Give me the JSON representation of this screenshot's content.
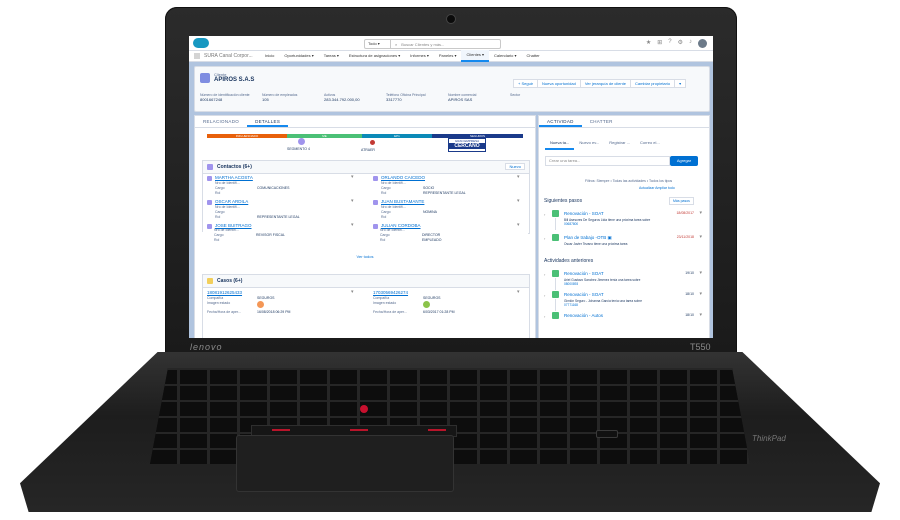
{
  "laptop": {
    "brand": "lenovo",
    "model": "T550",
    "logo": "ThinkPad"
  },
  "sf": {
    "search": {
      "scope": "Todo ▾",
      "placeholder": "Buscar Clientes y más..."
    },
    "app_name": "SURA Canal Corpor...",
    "nav_tabs": [
      "Inicio",
      "Oportunidades ▾",
      "Tareas ▾",
      "Estructura de asignaciones ▾",
      "Informes ▾",
      "Paneles ▾",
      "Clientes ▾",
      "Calendario ▾",
      "Chatter"
    ],
    "active_tab": "Clientes ▾",
    "record": {
      "object": "Cliente",
      "name": "APIROS S.A.S",
      "actions": [
        "+ Seguir",
        "Nueva oportunidad",
        "Ver jerarquía de cliente",
        "Cambiar propietario",
        "▾"
      ],
      "fields": [
        {
          "label": "Número de identificación cliente",
          "value": "8001667248"
        },
        {
          "label": "Número de empleados",
          "value": "105"
        },
        {
          "label": "Activos",
          "value": "283.344.792.000,00"
        },
        {
          "label": "Teléfono Oficina Principal",
          "value": "3317770"
        },
        {
          "label": "Nombre comercial",
          "value": "APIROS SAS"
        },
        {
          "label": "Sector",
          "value": ""
        }
      ]
    },
    "left_tabs": [
      "RELACIONADO",
      "DETALLES"
    ],
    "path": {
      "segments": [
        "INFLUENCIADO",
        "ME",
        "EP1",
        "SEGUROS"
      ],
      "colors": [
        "#e8600a",
        "#4bc076",
        "#0b8ab8",
        "#1a3a8a"
      ],
      "label1": "SEGMENTO 4",
      "label2": "ATRAER",
      "gran1": "GRAN EMPRESA",
      "gran2": "CERCANO"
    },
    "contacts": {
      "title": "Contactos (6+)",
      "button": "Nuevo",
      "items": [
        {
          "name": "MARTHA ACOSTA",
          "cargo": "",
          "rol": "COMUNICACIONES"
        },
        {
          "name": "ORLANDO CAICEDO",
          "cargo": "SOCIO",
          "rol": "REPRESENTANTE LEGAL"
        },
        {
          "name": "OSCAR ARDILA",
          "cargo": "",
          "rol": "REPRESENTANTE LEGAL"
        },
        {
          "name": "JUAN BUSTAMANTE",
          "cargo": "",
          "rol": "NOMINA"
        },
        {
          "name": "JOSE BUITRAGO",
          "cargo": "",
          "rol": "REVISOR FISCAL"
        },
        {
          "name": "JULIAN CORDOBA",
          "cargo": "DIRECTOR",
          "rol": "EMPLEADO"
        }
      ],
      "lbl_ident": "Nro de Identifi...",
      "lbl_cargo": "Cargo",
      "lbl_rol": "Rol",
      "see_all": "Ver todos"
    },
    "cases": {
      "title": "Casos (6+)",
      "items": [
        {
          "num": "18081912625433",
          "company": "SEGUROS",
          "date": "16/08/2018 06:29 PM"
        },
        {
          "num": "17030569426274",
          "company": "SEGUROS",
          "date": "6/03/2017 01:28 PM"
        }
      ],
      "lbl_company": "Compañía",
      "lbl_state": "Imagen estado",
      "lbl_date": "Fecha/Hora de aper..."
    },
    "right_tabs": [
      "ACTIVIDAD",
      "CHATTER"
    ],
    "activity_tabs": [
      "Nueva ta...",
      "Nuevo ev...",
      "Registrar ...",
      "Correo el..."
    ],
    "task_placeholder": "Crear una tarea...",
    "add_button": "Agregar",
    "filters": "Filtros: Siempre • Todas las actividades • Todos los tipos",
    "filter_links": "Actualizar  Ampliar todo",
    "next_steps": "Siguientes pasos",
    "more_steps": "Más pasos",
    "next_items": [
      {
        "title": "Renovación - SOAT",
        "date": "18/08/2017",
        "desc": "Bill Asesores De Seguros Ltda  tiene una próxima tarea sobre",
        "desc2": "00687800"
      },
      {
        "title": "Plan de trabajo -OTB  ▣",
        "date": "23/11/2018",
        "desc": "Oscar Javier Tezano  tiene una próxima tarea",
        "desc2": ""
      }
    ],
    "past_title": "Actividades anteriores",
    "past_items": [
      {
        "title": "Renovación - SOAT",
        "date": "19/10",
        "desc": "Ariel Gustavo Sanchez Jimenez  tenía una tarea sobre",
        "desc2": "08000893"
      },
      {
        "title": "Renovación - SOAT",
        "date": "18/10",
        "desc": "Gimlón Seguro - Johanna García  tenía una tarea sobre",
        "desc2": "07771168"
      },
      {
        "title": "Renovación - Autos",
        "date": "18/10",
        "desc": "",
        "desc2": ""
      }
    ]
  }
}
